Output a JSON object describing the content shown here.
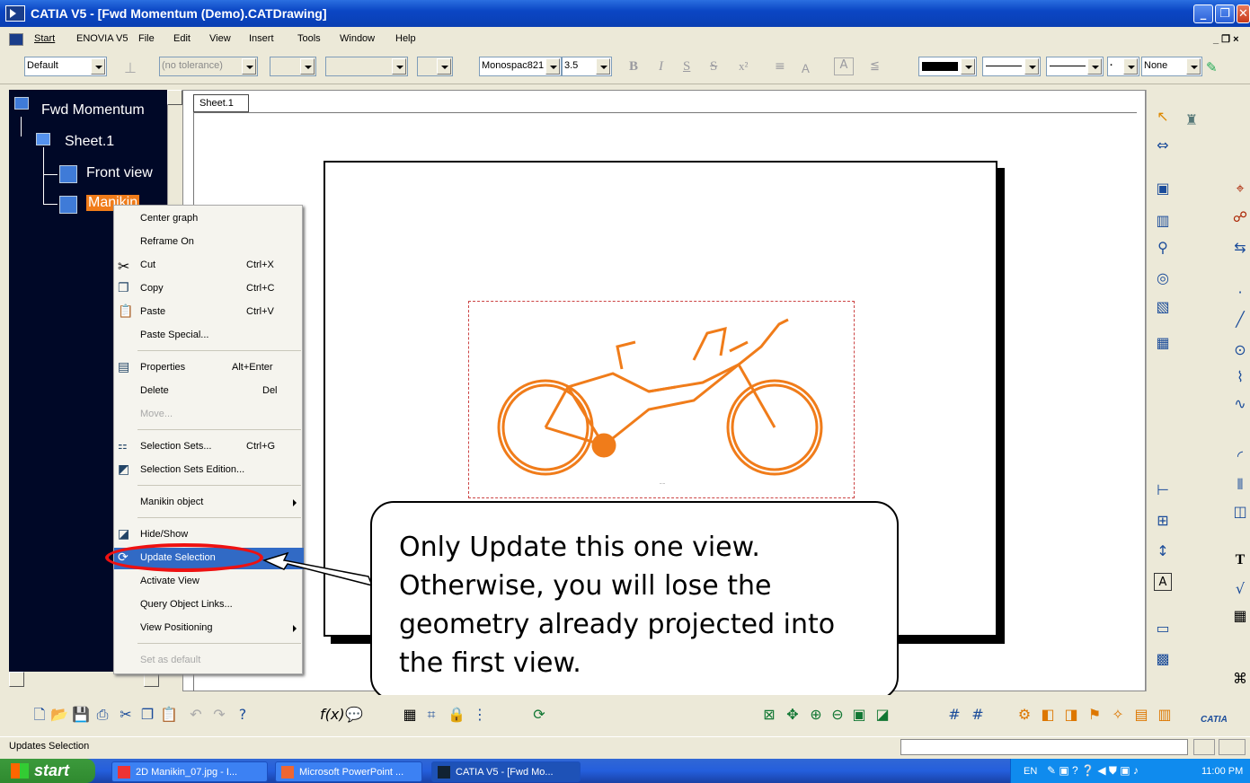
{
  "window": {
    "title": "CATIA V5 - [Fwd Momentum (Demo).CATDrawing]"
  },
  "menubar": [
    "Start",
    "ENOVIA V5",
    "File",
    "Edit",
    "View",
    "Insert",
    "Tools",
    "Window",
    "Help"
  ],
  "toolbar": {
    "style": "Default",
    "tolerance": "(no tolerance)",
    "font": "Monospac821",
    "font_size": "3.5",
    "bold": "B",
    "italic": "I",
    "underline": "S",
    "strike": "S",
    "superscript": "x²",
    "line_none": "None"
  },
  "tree": {
    "root": "Fwd Momentum",
    "sheet": "Sheet.1",
    "front_view": "Front view",
    "manikin": "Manikin"
  },
  "sheet_tab": "Sheet.1",
  "context_menu": {
    "items": [
      {
        "label": "Center graph",
        "shortcut": ""
      },
      {
        "label": "Reframe On",
        "shortcut": ""
      },
      {
        "label": "Cut",
        "shortcut": "Ctrl+X"
      },
      {
        "label": "Copy",
        "shortcut": "Ctrl+C"
      },
      {
        "label": "Paste",
        "shortcut": "Ctrl+V"
      },
      {
        "label": "Paste Special...",
        "shortcut": ""
      },
      {
        "label": "Properties",
        "shortcut": "Alt+Enter"
      },
      {
        "label": "Delete",
        "shortcut": "Del"
      },
      {
        "label": "Move...",
        "shortcut": ""
      },
      {
        "label": "Selection Sets...",
        "shortcut": "Ctrl+G"
      },
      {
        "label": "Selection Sets Edition...",
        "shortcut": ""
      },
      {
        "label": "Manikin object",
        "shortcut": ""
      },
      {
        "label": "Hide/Show",
        "shortcut": ""
      },
      {
        "label": "Update Selection",
        "shortcut": ""
      },
      {
        "label": "Activate View",
        "shortcut": ""
      },
      {
        "label": "Query Object Links...",
        "shortcut": ""
      },
      {
        "label": "View Positioning",
        "shortcut": ""
      },
      {
        "label": "Set as default",
        "shortcut": ""
      }
    ]
  },
  "callout": {
    "lines": [
      "Only Update this one view.",
      "Otherwise, you will lose the",
      "geometry already projected into",
      "the first view."
    ]
  },
  "status": {
    "text": "Updates Selection"
  },
  "taskbar": {
    "start": "start",
    "tasks": [
      "2D Manikin_07.jpg - I...",
      "Microsoft PowerPoint ...",
      "CATIA V5 - [Fwd Mo..."
    ],
    "lang": "EN",
    "clock": "11:00 PM"
  },
  "branding": {
    "catia": "CATIA"
  },
  "colors": {
    "drawing": "#f07c1a",
    "highlight": "#316ac5",
    "tree_bg": "#000827",
    "callout_ring": "#e11111"
  }
}
